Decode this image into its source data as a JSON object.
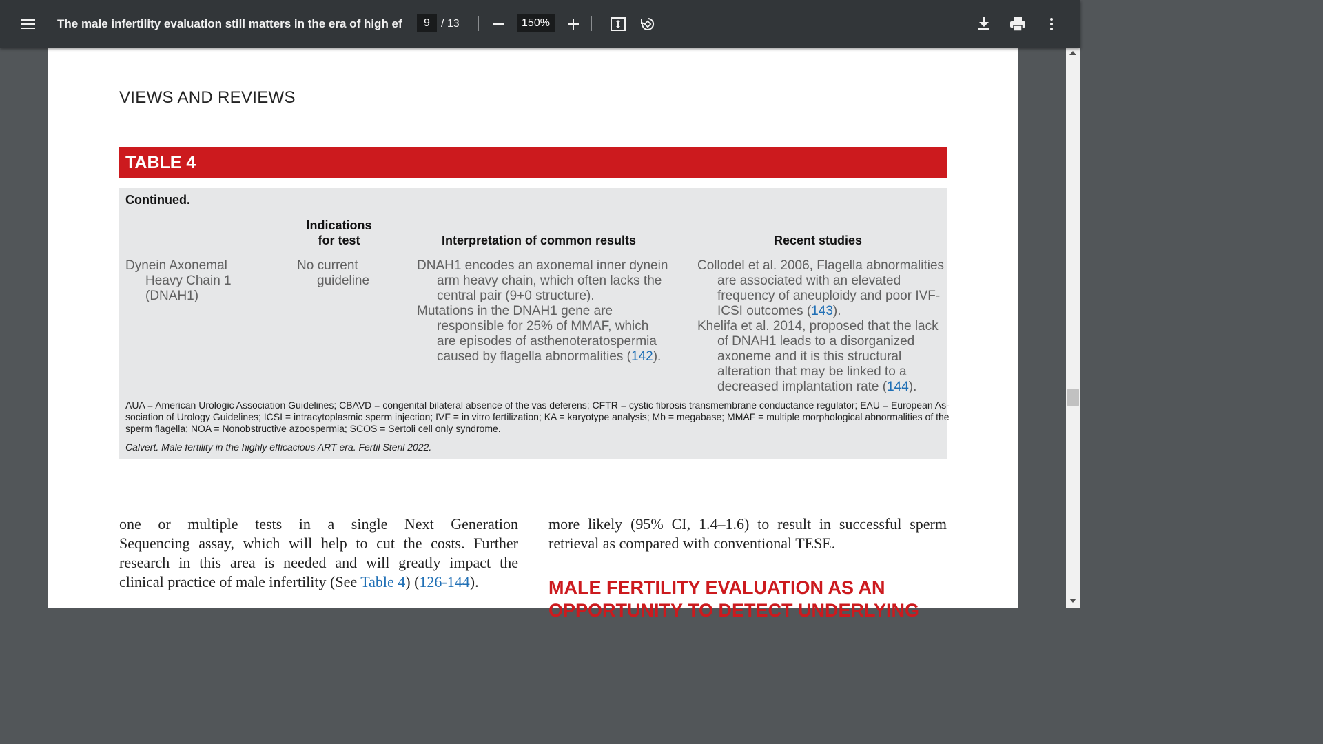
{
  "toolbar": {
    "title": "The male infertility evaluation still matters in the era of high effi...",
    "page_current": "9",
    "page_total": "/ 13",
    "zoom": "150%",
    "icons": [
      "menu-icon",
      "minus-icon",
      "plus-icon",
      "fit-page-icon",
      "rotate-icon",
      "download-icon",
      "print-icon",
      "more-vert-icon"
    ]
  },
  "page": {
    "section_header": "VIEWS AND REVIEWS",
    "table_label": "TABLE 4",
    "continued": "Continued.",
    "headers": {
      "indications_1": "Indications",
      "indications_2": "for test",
      "interpretation": "Interpretation of common results",
      "recent": "Recent studies"
    },
    "test_name": [
      "Dynein Axonemal",
      "Heavy Chain 1",
      "(DNAH1)"
    ],
    "indication": [
      "No current",
      "guideline"
    ],
    "interpretation_lines": [
      "DNAH1 encodes an axonemal inner dynein",
      "arm heavy chain, which often lacks the",
      "central pair (9+0 structure).",
      "Mutations in the DNAH1 gene are",
      "responsible for 25% of MMAF, which",
      "are episodes of asthenoteratospermia",
      "caused by flagella abnormalities ("
    ],
    "interpretation_ref": "142",
    "recent_lines": [
      "Collodel et al. 2006, Flagella abnormalities",
      "are associated with an elevated",
      "frequency of aneuploidy and poor IVF-",
      "ICSI outcomes (",
      "Khelifa et al. 2014, proposed that the lack",
      "of DNAH1 leads to a disorganized",
      "axoneme and it is this structural",
      "alteration that may be linked to a",
      "decreased implantation rate ("
    ],
    "recent_ref_1": "143",
    "recent_ref_2": "144",
    "close_paren": ").",
    "abbreviations": [
      "AUA = American Urologic Association Guidelines; CBAVD = congenital bilateral absence of the vas deferens; CFTR = cystic fibrosis transmembrane conductance regulator; EAU = European As-",
      "sociation of Urology Guidelines; ICSI = intracytoplasmic sperm injection; IVF = in vitro fertilization; KA = karyotype analysis; Mb = megabase; MMAF = multiple morphological abnormalities of the",
      "sperm flagella; NOA = Nonobstructive azoospermia; SCOS = Sertoli cell only syndrome."
    ],
    "citation": "Calvert. Male fertility in the highly efficacious ART era. Fertil Steril 2022.",
    "left_col": [
      "one or multiple tests in a single Next Generation",
      "Sequencing assay, which will help to cut the costs. Further",
      "research in this area is needed and will greatly impact the"
    ],
    "left_last_prefix": "clinical practice of male infertility (See ",
    "left_link_table": "Table 4",
    "left_mid": ") (",
    "left_link_refs": "126-144",
    "left_end": ").",
    "right_col": [
      "more likely (95% CI, 1.4–1.6) to result in successful sperm",
      "retrieval as compared with conventional TESE."
    ],
    "heading_line1": "MALE FERTILITY EVALUATION AS AN",
    "heading_line2": "OPPORTUNITY TO DETECT UNDERLYING"
  },
  "colors": {
    "toolbar_bg": "#323639",
    "viewer_bg": "#525659",
    "accent_red": "#cc1a1e",
    "table_bg": "#e6e7e8",
    "link_blue": "#1f6fb5"
  }
}
